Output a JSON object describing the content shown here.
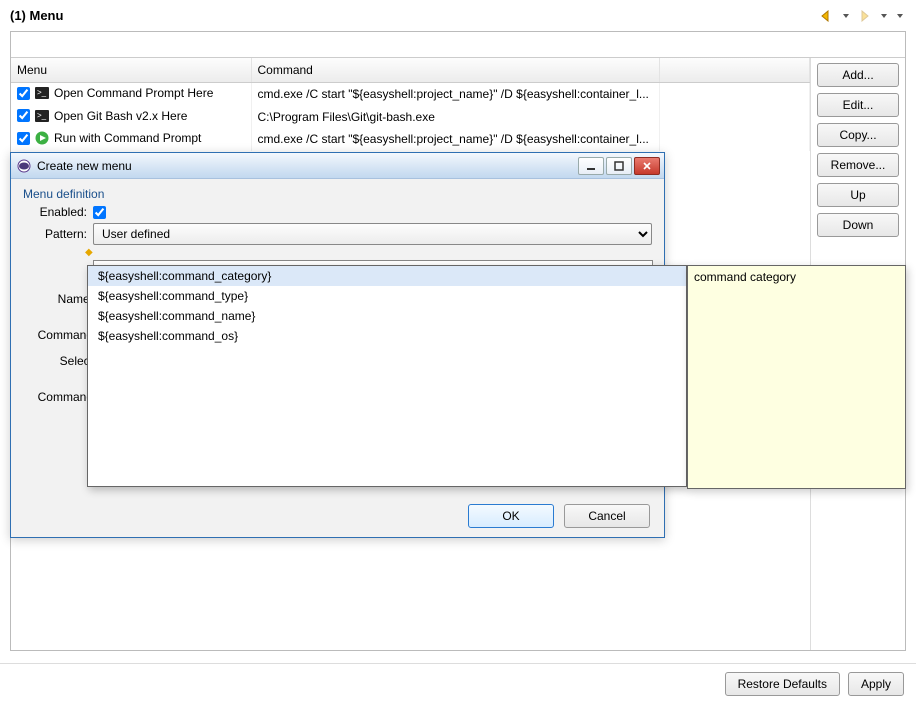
{
  "header": {
    "title": "(1) Menu"
  },
  "table": {
    "columns": {
      "menu": "Menu",
      "command": "Command"
    },
    "rows": [
      {
        "checked": true,
        "icon": "terminal",
        "menu": "Open Command Prompt Here",
        "command": "cmd.exe /C start \"${easyshell:project_name}\" /D ${easyshell:container_l..."
      },
      {
        "checked": true,
        "icon": "terminal",
        "menu": "Open Git Bash v2.x Here",
        "command": "C:\\Program Files\\Git\\git-bash.exe"
      },
      {
        "checked": true,
        "icon": "run",
        "menu": "Run with Command Prompt",
        "command": "cmd.exe /C start \"${easyshell:project_name}\" /D ${easyshell:container_l..."
      }
    ]
  },
  "side_buttons": {
    "add": "Add...",
    "edit": "Edit...",
    "copy": "Copy...",
    "remove": "Remove...",
    "up": "Up",
    "down": "Down"
  },
  "dialog": {
    "title": "Create new menu",
    "section": "Menu definition",
    "enabled_label": "Enabled:",
    "enabled": true,
    "pattern_label": "Pattern:",
    "pattern_value": "User defined",
    "name_label": "Name:",
    "command_label": "Command",
    "select_label": "Select",
    "command2_label": "Command",
    "ok": "OK",
    "cancel": "Cancel"
  },
  "autocomplete": {
    "items": [
      "${easyshell:command_category}",
      "${easyshell:command_type}",
      "${easyshell:command_name}",
      "${easyshell:command_os}"
    ],
    "selected": 0
  },
  "tooltip": {
    "text": "command category"
  },
  "bottom": {
    "restore": "Restore Defaults",
    "apply": "Apply"
  }
}
